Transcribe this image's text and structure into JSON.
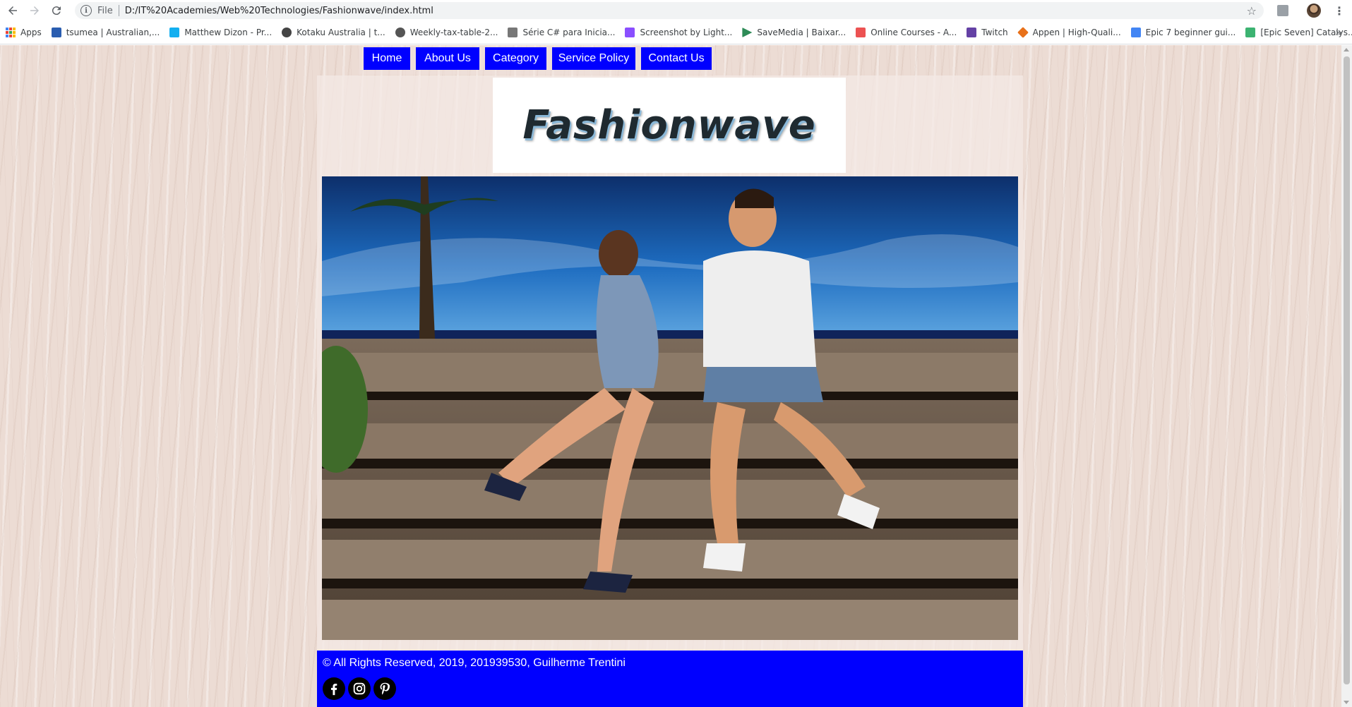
{
  "browser": {
    "scheme": "File",
    "url": "D:/IT%20Academies/Web%20Technologies/Fashionwave/index.html"
  },
  "bookmarks": [
    {
      "label": "Apps",
      "icon": "apps-grid-icon"
    },
    {
      "label": "tsumea | Australian,...",
      "icon": "tsumea-icon",
      "color": "#2a5db0"
    },
    {
      "label": "Matthew Dizon - Pr...",
      "icon": "artstation-icon",
      "color": "#13aff0"
    },
    {
      "label": "Kotaku Australia | t...",
      "icon": "kotaku-icon",
      "color": "#444444"
    },
    {
      "label": "Weekly-tax-table-2...",
      "icon": "document-icon",
      "color": "#555555"
    },
    {
      "label": "Série C# para Inicia...",
      "icon": "video-icon",
      "color": "#777777"
    },
    {
      "label": "Screenshot by Light...",
      "icon": "lightshot-icon",
      "color": "#8a4fff"
    },
    {
      "label": "SaveMedia | Baixar...",
      "icon": "savemedia-icon",
      "color": "#2e8b57"
    },
    {
      "label": "Online Courses - A...",
      "icon": "udemy-icon",
      "color": "#ec5252"
    },
    {
      "label": "Twitch",
      "icon": "twitch-icon",
      "color": "#6441a5"
    },
    {
      "label": "Appen | High-Quali...",
      "icon": "appen-icon",
      "color": "#e8711a"
    },
    {
      "label": "Epic 7 beginner gui...",
      "icon": "google-docs-icon",
      "color": "#4285f4"
    },
    {
      "label": "[Epic Seven] Catalys...",
      "icon": "game-icon",
      "color": "#3cb371"
    }
  ],
  "site": {
    "nav": [
      "Home",
      "About Us",
      "Category",
      "Service Policy",
      "Contact Us"
    ],
    "logo": "Fashionwave",
    "hero_alt": "Fashion couple sitting on wooden beach steps",
    "footer": "© All Rights Reserved, 2019, 201939530, Guilherme Trentini",
    "social": [
      "facebook-icon",
      "instagram-icon",
      "pinterest-icon"
    ],
    "accent": "#0000ff"
  }
}
